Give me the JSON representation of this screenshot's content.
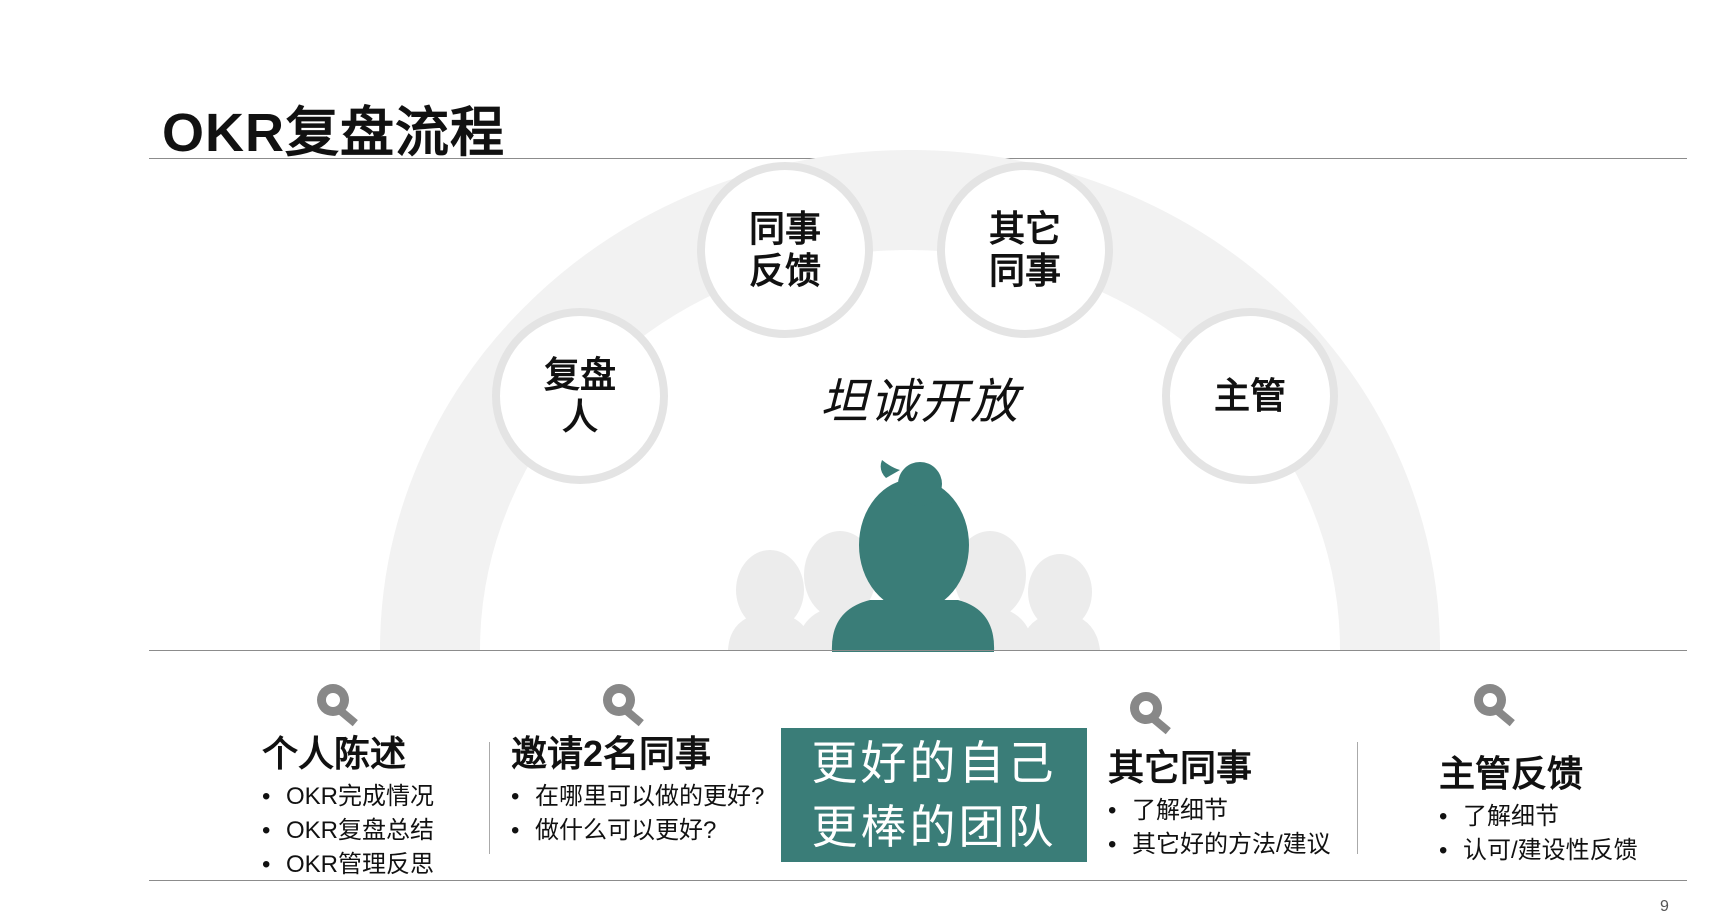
{
  "title": "OKR复盘流程",
  "center_text": "坦诚开放",
  "circles": {
    "reviewer": "复盘\n人",
    "peer_feedback": "同事\n反馈",
    "other_peers": "其它\n同事",
    "manager": "主管"
  },
  "highlight": {
    "line1": "更好的自己",
    "line2": "更棒的团队"
  },
  "columns": [
    {
      "title": "个人陈述",
      "items": [
        "OKR完成情况",
        "OKR复盘总结",
        "OKR管理反思"
      ]
    },
    {
      "title": "邀请2名同事",
      "items": [
        "在哪里可以做的更好?",
        "做什么可以更好?"
      ]
    },
    {
      "title": "其它同事",
      "items": [
        "了解细节",
        "其它好的方法/建议"
      ]
    },
    {
      "title": "主管反馈",
      "items": [
        "了解细节",
        "认可/建设性反馈"
      ]
    }
  ],
  "page_number": "9",
  "colors": {
    "accent": "#3a7d78",
    "arc": "#f1f1f1",
    "circle_border": "#e3e3e3",
    "silhouette": "#e8e8e8"
  },
  "icons": [
    "gear-icon"
  ]
}
